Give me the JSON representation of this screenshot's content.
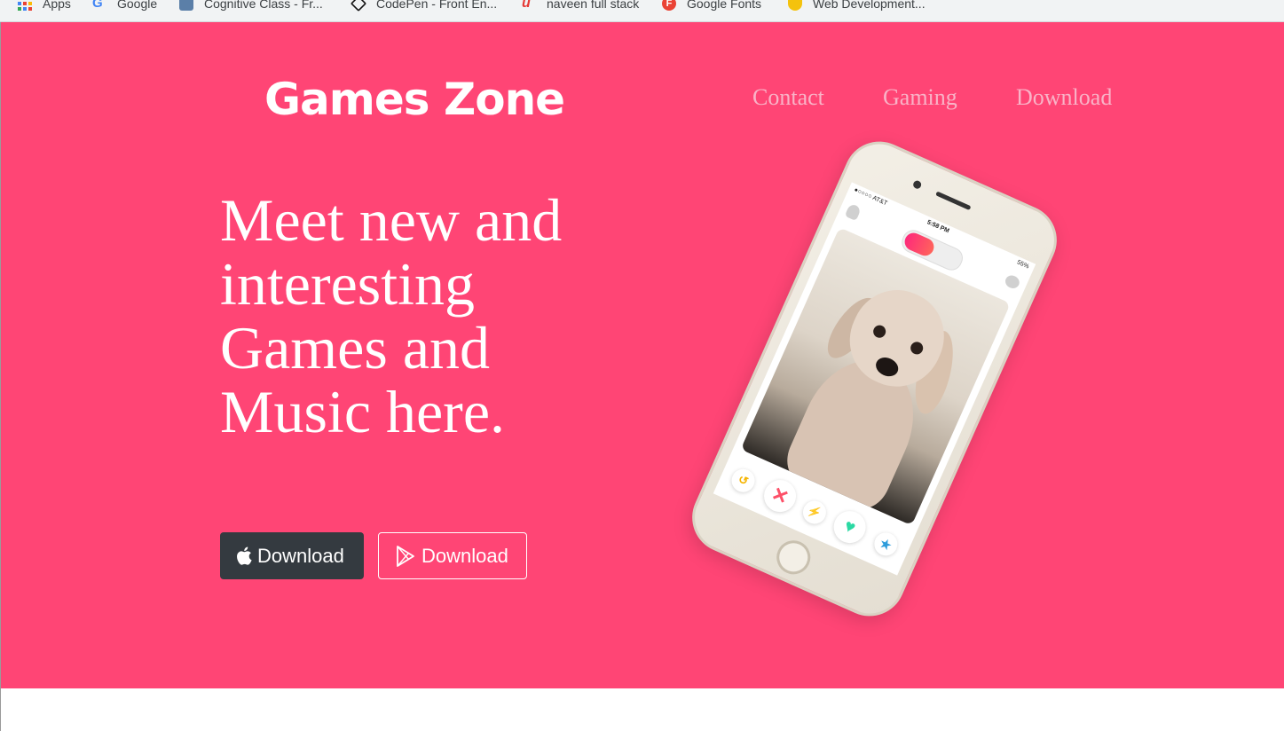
{
  "bookmarks": [
    {
      "label": "Apps",
      "icon": "apps-grid-icon"
    },
    {
      "label": "Google",
      "icon": "google-icon"
    },
    {
      "label": "Cognitive Class - Fr...",
      "icon": "cognitive-class-icon"
    },
    {
      "label": "CodePen - Front En...",
      "icon": "codepen-icon"
    },
    {
      "label": "naveen full stack",
      "icon": "naveen-icon"
    },
    {
      "label": "Google Fonts",
      "icon": "google-fonts-icon"
    },
    {
      "label": "Web Development...",
      "icon": "web-dev-icon"
    }
  ],
  "brand": "Games Zone",
  "nav": [
    "Contact",
    "Gaming",
    "Download"
  ],
  "headline": "Meet new and interesting Games and Music here.",
  "buttons": {
    "apple_download": "Download",
    "play_download": "Download"
  },
  "phone": {
    "carrier": "●○○○○ AT&T",
    "time": "5:58 PM",
    "battery": "55%"
  },
  "colors": {
    "hero_bg": "#ff4575",
    "nav_text": "#f9b3c7",
    "dark_button": "#343a40"
  }
}
